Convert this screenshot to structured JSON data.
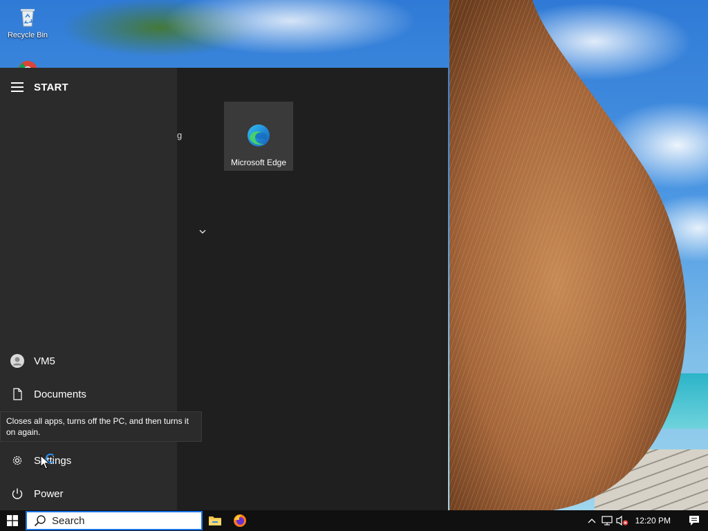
{
  "desktop": {
    "icons": [
      {
        "label": "Recycle Bin",
        "icon": "recycle-bin-icon"
      },
      {
        "label": "",
        "icon": "chrome-icon"
      }
    ]
  },
  "start_menu": {
    "title": "START",
    "user": "VM5",
    "documents": "Documents",
    "settings": "Settings",
    "power": "Power",
    "cut_text": "g",
    "tooltip": "Closes all apps, turns off the PC, and then turns it on again.",
    "tiles": [
      {
        "label": "Microsoft Edge",
        "icon": "edge-icon"
      }
    ]
  },
  "taskbar": {
    "search_placeholder": "Search",
    "apps": [
      "file-explorer-icon",
      "firefox-icon"
    ],
    "time": "12:20 PM",
    "accent": "#1a73e8"
  }
}
